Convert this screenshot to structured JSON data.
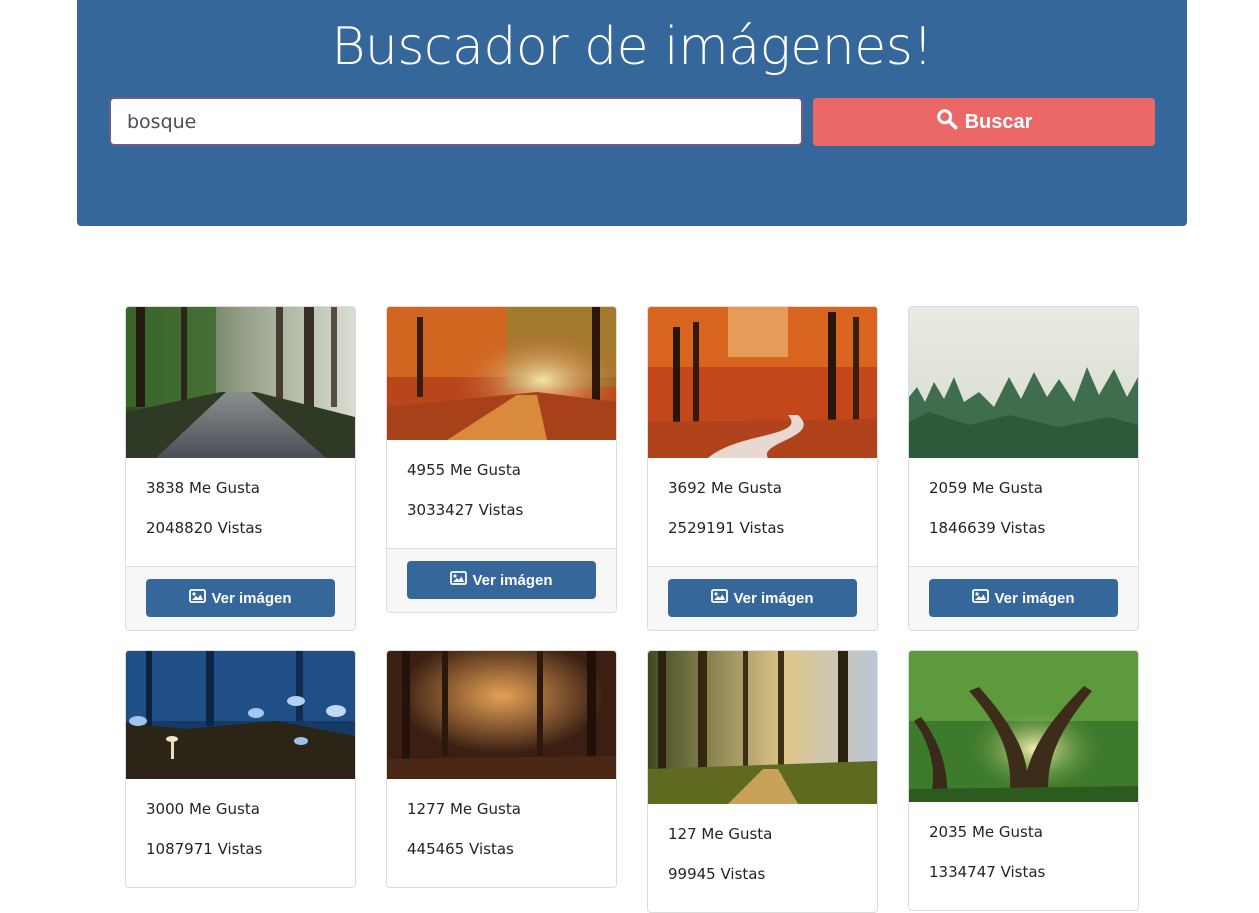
{
  "header": {
    "title": "Buscador de imágenes!",
    "search_value": "bosque",
    "search_button_label": "Buscar",
    "search_icon": "search-icon"
  },
  "colors": {
    "hero": "#35679a",
    "search_button": "#ec6866",
    "view_button": "#35679a"
  },
  "results": [
    {
      "likes": "3838 Me Gusta",
      "views": "2048820 Vistas",
      "button": "Ver imágen",
      "image_icon": "image-icon"
    },
    {
      "likes": "4955 Me Gusta",
      "views": "3033427 Vistas",
      "button": "Ver imágen",
      "image_icon": "image-icon"
    },
    {
      "likes": "3692 Me Gusta",
      "views": "2529191 Vistas",
      "button": "Ver imágen",
      "image_icon": "image-icon"
    },
    {
      "likes": "2059 Me Gusta",
      "views": "1846639 Vistas",
      "button": "Ver imágen",
      "image_icon": "image-icon"
    },
    {
      "likes": "3000 Me Gusta",
      "views": "1087971 Vistas"
    },
    {
      "likes": "1277 Me Gusta",
      "views": "445465 Vistas"
    },
    {
      "likes": "127 Me Gusta",
      "views": "99945 Vistas"
    },
    {
      "likes": "2035 Me Gusta",
      "views": "1334747 Vistas"
    }
  ]
}
